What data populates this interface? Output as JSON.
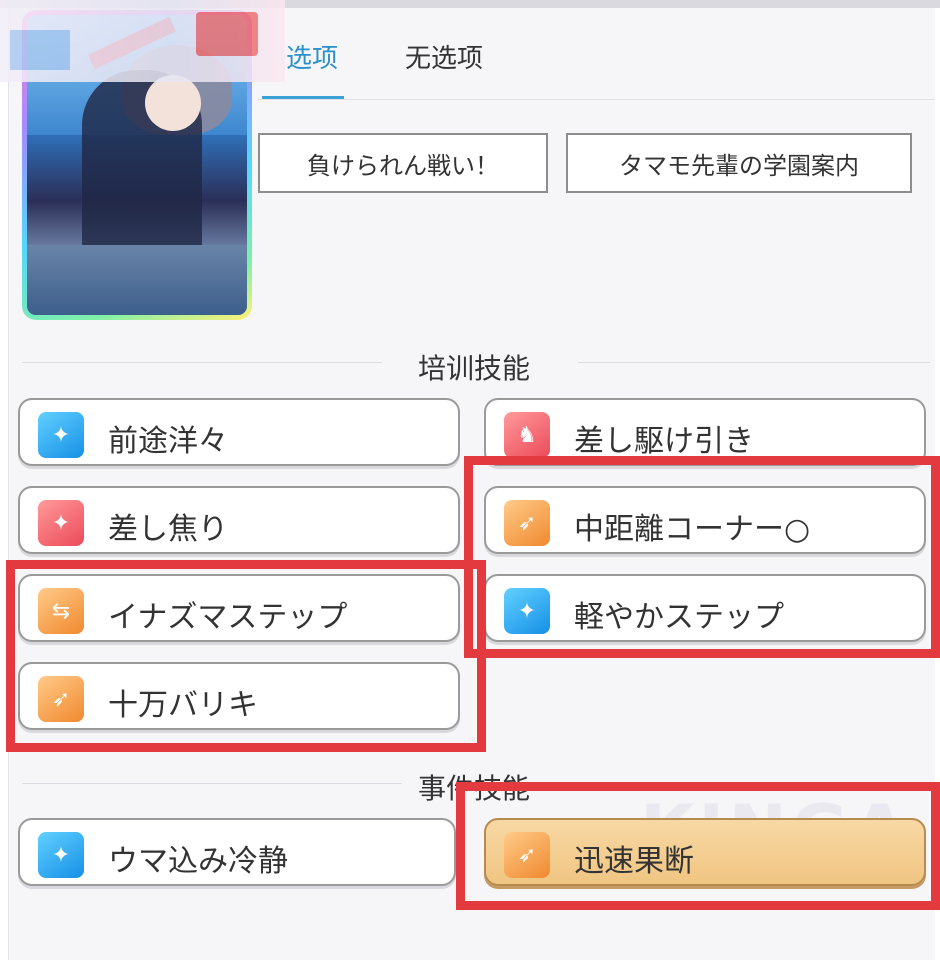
{
  "tabs": [
    {
      "label": "选项",
      "active": true
    },
    {
      "label": "无选项",
      "active": false
    }
  ],
  "choices": [
    {
      "label": "負けられん戦い！"
    },
    {
      "label": "タマモ先輩の学園案内"
    }
  ],
  "sections": {
    "training": {
      "title": "培训技能",
      "skills": [
        {
          "label": "前途洋々",
          "icon": "sparkle-icon",
          "color": "blue"
        },
        {
          "label": "差し駆け引き",
          "icon": "devil-icon",
          "color": "red"
        },
        {
          "label": "差し焦り",
          "icon": "sparkle-icon",
          "color": "red"
        },
        {
          "label": "中距離コーナー○",
          "icon": "runner-icon",
          "color": "orange"
        },
        {
          "label": "イナズマステップ",
          "icon": "arrows-icon",
          "color": "orange"
        },
        {
          "label": "軽やかステップ",
          "icon": "sparkle-icon",
          "color": "blue"
        },
        {
          "label": "十万バリキ",
          "icon": "runner-icon",
          "color": "orange"
        }
      ]
    },
    "event": {
      "title": "事件技能",
      "skills": [
        {
          "label": "ウマ込み冷静",
          "icon": "sparkle-icon",
          "color": "blue"
        },
        {
          "label": "迅速果断",
          "icon": "runner-icon",
          "color": "gold"
        }
      ]
    }
  },
  "colors": {
    "accent": "#2b91c8",
    "highlight": "#e23a3f",
    "gold_skill": "#f0c582"
  }
}
